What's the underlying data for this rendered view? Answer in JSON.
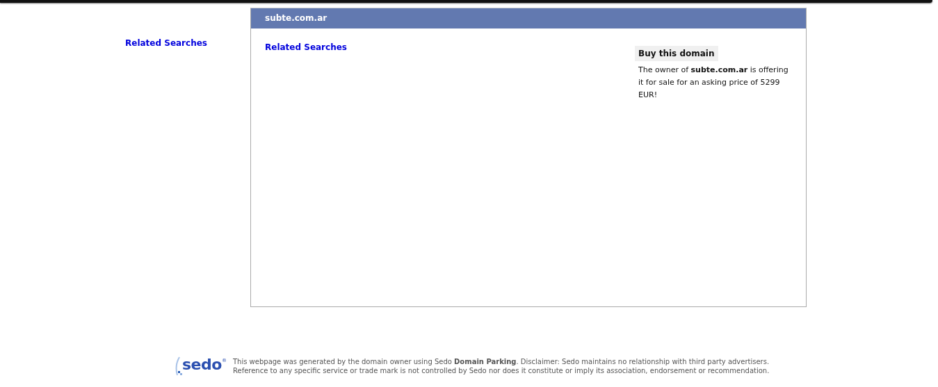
{
  "sidebar": {
    "related_searches": "Related Searches"
  },
  "panel": {
    "title": "subte.com.ar",
    "related_searches": "Related Searches",
    "buy_box": {
      "heading": "Buy this domain",
      "text": "The owner of **subte.com.ar** is offering it for sale for an asking price of 5299 EUR!"
    }
  },
  "footer": {
    "logo": "sedo",
    "logo_mark": "®",
    "text": "This webpage was generated by the domain owner using Sedo **Domain Parking**. Disclaimer: Sedo maintains no relationship with third party advertisers. Reference to any specific service or trade mark is not controlled by Sedo nor does it constitute or imply its association, endorsement or recommendation."
  }
}
